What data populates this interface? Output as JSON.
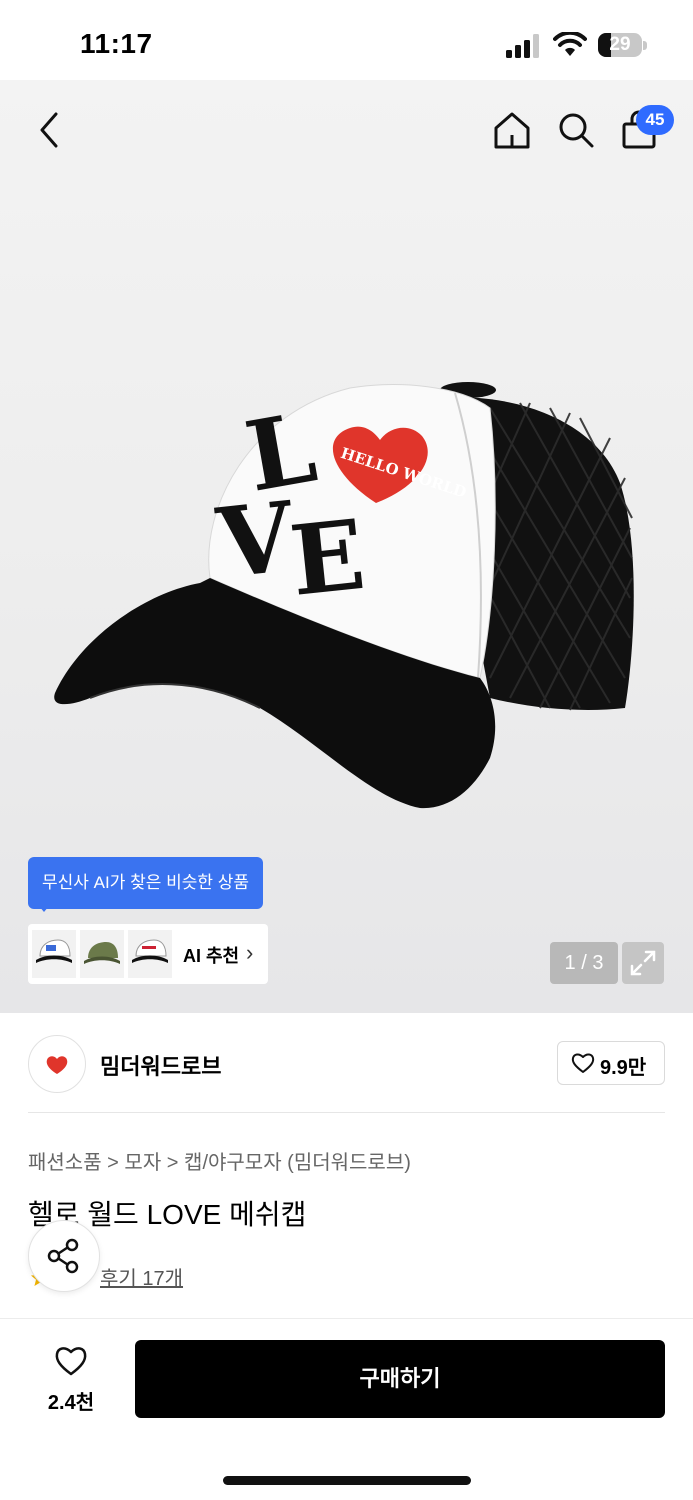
{
  "status_bar": {
    "time": "11:17",
    "battery": "29",
    "battery_level_pct": 29
  },
  "header": {
    "cart_count": "45"
  },
  "ai_recommend": {
    "tooltip": "무신사 AI가 찾은 비슷한 상품",
    "label": "AI 추천"
  },
  "gallery": {
    "pager": "1 / 3"
  },
  "brand": {
    "name": "밈더워드로브",
    "likes": "9.9만"
  },
  "breadcrumb": {
    "cat1": "패션소품",
    "sep": ">",
    "cat2": "모자",
    "cat3": "캡/야구모자 (밈더워드로브)"
  },
  "product": {
    "title": "헬로 월드 LOVE 메쉬캡",
    "reviews": "후기 17개"
  },
  "bottom": {
    "wish_count": "2.4천",
    "buy_label": "구매하기"
  },
  "cap_print": {
    "letters": [
      "L",
      "V",
      "E"
    ],
    "heart_text": "HELLO WORLD"
  },
  "colors": {
    "accent_blue": "#2f6bff",
    "heart_red": "#e0352b"
  }
}
